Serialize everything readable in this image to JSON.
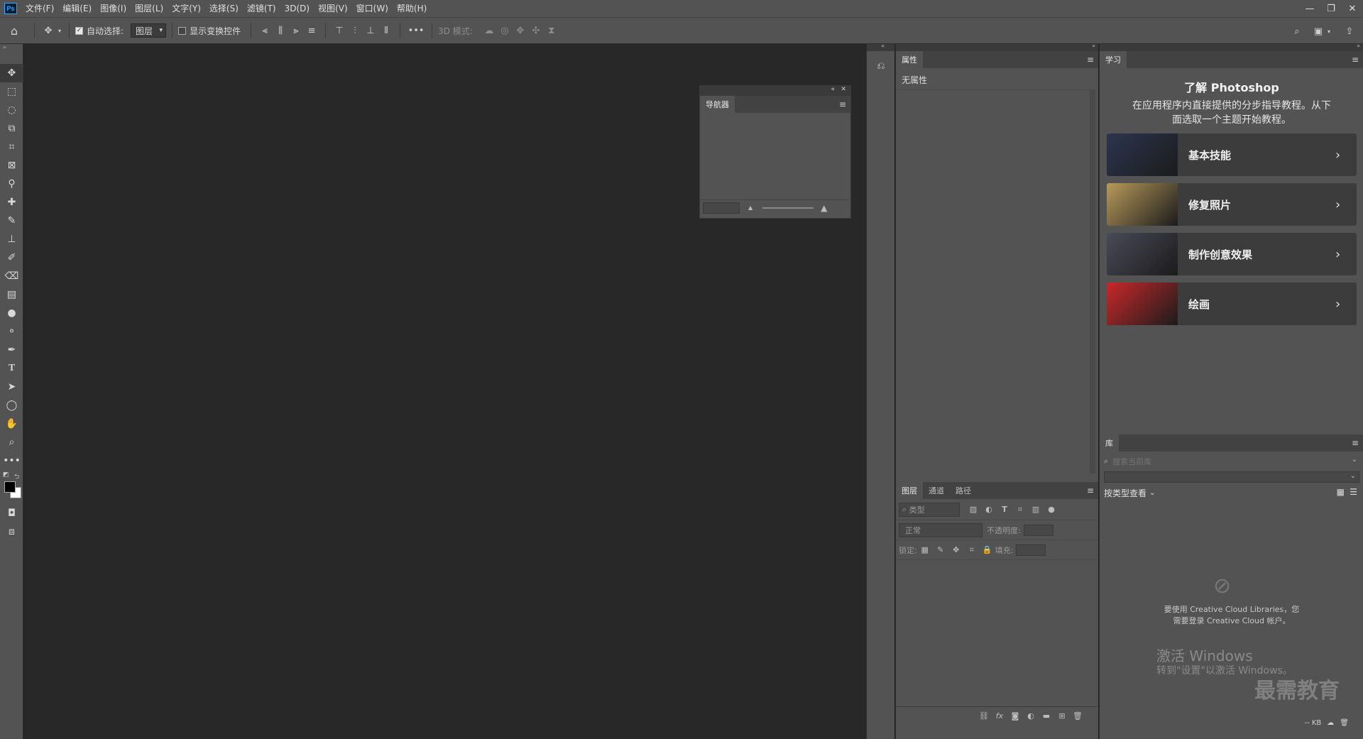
{
  "app": {
    "logo": "Ps"
  },
  "menu": [
    "文件(F)",
    "编辑(E)",
    "图像(I)",
    "图层(L)",
    "文字(Y)",
    "选择(S)",
    "滤镜(T)",
    "3D(D)",
    "视图(V)",
    "窗口(W)",
    "帮助(H)"
  ],
  "window_controls": {
    "minimize": "—",
    "restore": "❐",
    "close": "✕"
  },
  "options": {
    "auto_select_label": "自动选择:",
    "auto_select_checked": true,
    "layer_select_value": "图层",
    "show_transform_label": "显示变换控件",
    "show_transform_checked": false,
    "more": "•••",
    "mode_3d_label": "3D 模式:"
  },
  "navigator": {
    "tab": "导航器"
  },
  "properties": {
    "tab": "属性",
    "empty_text": "无属性"
  },
  "layers": {
    "tabs": [
      "图层",
      "通道",
      "路径"
    ],
    "filter_placeholder": "类型",
    "blend_mode": "正常",
    "opacity_label": "不透明度:",
    "lock_label": "锁定:",
    "fill_label": "填充:"
  },
  "learn": {
    "tab": "学习",
    "title": "了解 Photoshop",
    "description_line1": "在应用程序内直接提供的分步指导教程。从下",
    "description_line2": "面选取一个主题开始教程。",
    "items": [
      {
        "label": "基本技能",
        "thumb_color": "#2b3550"
      },
      {
        "label": "修复照片",
        "thumb_color": "#b89a5a"
      },
      {
        "label": "制作创意效果",
        "thumb_color": "#4a4a58"
      },
      {
        "label": "绘画",
        "thumb_color": "#c8282a"
      }
    ]
  },
  "library": {
    "tab": "库",
    "search_placeholder": "搜索当前库",
    "view_by": "按类型查看",
    "message_line1": "要使用 Creative Cloud Libraries，您",
    "message_line2": "需要登录 Creative Cloud 帐户。",
    "status_kb": "-- KB"
  },
  "watermark": {
    "title": "激活 Windows",
    "subtitle": "转到\"设置\"以激活 Windows。",
    "brand": "最需教育"
  },
  "colors": {
    "foreground": "#000000",
    "background": "#ffffff"
  }
}
